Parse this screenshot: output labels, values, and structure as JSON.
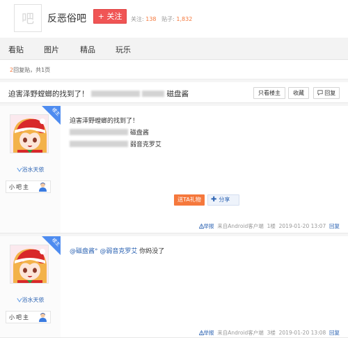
{
  "forum": {
    "logo_char": "吧",
    "name": "反恶俗吧",
    "follow_label": "+ 关注",
    "members_label": "关注:",
    "members": "138",
    "posts_label": "贴子:",
    "posts": "1,832"
  },
  "nav": {
    "tabs": [
      "看贴",
      "图片",
      "精品",
      "玩乐"
    ]
  },
  "pager": {
    "count": "2",
    "text": "回复贴，共1页"
  },
  "thread": {
    "title_start": "迫害泽野螳螂的找到了！",
    "title_end": "磁盘酱",
    "only_op_label": "只看楼主",
    "favorite_label": "收藏",
    "reply_label": "回复"
  },
  "posts": [
    {
      "badge": "楼主",
      "username": "浴水天依",
      "role": "小吧主",
      "line1": "迫害泽野螳螂的找到了！",
      "line2_end": "磁盘酱",
      "line3_end": "弱音克罗艾",
      "gift_label": "送TA礼物",
      "share_label": "分享",
      "report_label": "举报",
      "source": "来自Android客户端",
      "floor": "1楼",
      "time": "2019-01-20 13:07",
      "reply": "回复"
    },
    {
      "badge": "楼主",
      "username": "浴水天依",
      "role": "小吧主",
      "mention1": "@磁盘酱°",
      "mention2": "@弱音克罗艾",
      "text": "你妈没了",
      "report_label": "举报",
      "source": "来自Android客户端",
      "floor": "3楼",
      "time": "2019-01-20 13:08",
      "reply": "回复"
    }
  ],
  "colors": {
    "accent": "#f05555",
    "link": "#2d64b3",
    "orange": "#f5783c",
    "badge": "#4e8cf0"
  }
}
